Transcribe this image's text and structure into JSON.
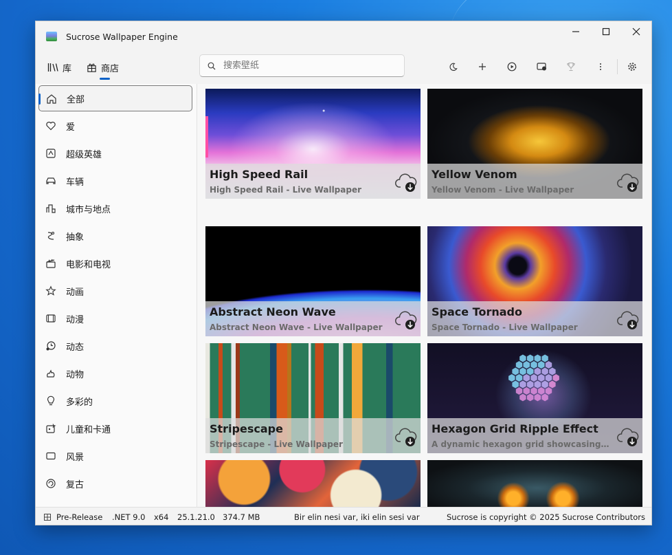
{
  "app": {
    "title": "Sucrose Wallpaper Engine"
  },
  "nav": {
    "library_label": "库",
    "store_label": "商店",
    "active": "store"
  },
  "search": {
    "placeholder": "搜索壁纸",
    "value": ""
  },
  "toolbar": {
    "icons": [
      "moon-icon",
      "plus-icon",
      "play-icon",
      "display-icon",
      "trophy-icon",
      "more-icon",
      "settings-icon"
    ]
  },
  "sidebar": {
    "items": [
      {
        "label": "全部",
        "icon": "home-icon",
        "selected": true
      },
      {
        "label": "爱",
        "icon": "heart-icon"
      },
      {
        "label": "超级英雄",
        "icon": "hero-icon"
      },
      {
        "label": "车辆",
        "icon": "car-icon"
      },
      {
        "label": "城市与地点",
        "icon": "city-icon"
      },
      {
        "label": "抽象",
        "icon": "abstract-icon"
      },
      {
        "label": "电影和电视",
        "icon": "clapper-icon"
      },
      {
        "label": "动画",
        "icon": "star-icon"
      },
      {
        "label": "动漫",
        "icon": "film-icon"
      },
      {
        "label": "动态",
        "icon": "dynamic-icon"
      },
      {
        "label": "动物",
        "icon": "animal-icon"
      },
      {
        "label": "多彩的",
        "icon": "bulb-icon"
      },
      {
        "label": "儿童和卡通",
        "icon": "kids-icon"
      },
      {
        "label": "风景",
        "icon": "landscape-icon"
      },
      {
        "label": "复古",
        "icon": "retro-icon"
      }
    ]
  },
  "wallpapers": [
    {
      "title": "High Speed Rail",
      "subtitle": "High Speed Rail - Live Wallpaper"
    },
    {
      "title": "Yellow Venom",
      "subtitle": "Yellow Venom - Live Wallpaper"
    },
    {
      "title": "Abstract Neon Wave",
      "subtitle": "Abstract Neon Wave - Live Wallpaper"
    },
    {
      "title": "Space Tornado",
      "subtitle": "Space Tornado - Live Wallpaper"
    },
    {
      "title": "Stripescape",
      "subtitle": "Stripescape - Live Wallpaper"
    },
    {
      "title": "Hexagon Grid Ripple Effect",
      "subtitle": "A dynamic hexagon grid showcasing an e..."
    }
  ],
  "status": {
    "channel": "Pre-Release",
    "framework": ".NET 9.0",
    "arch": "x64",
    "version": "25.1.21.0",
    "memory": "374.7 MB",
    "quote": "Bir elin nesi var, iki elin sesi var",
    "copyright": "Sucrose is copyright © 2025 Sucrose Contributors"
  },
  "colors": {
    "accent": "#0a62c8",
    "desktop": "#1466c9"
  }
}
